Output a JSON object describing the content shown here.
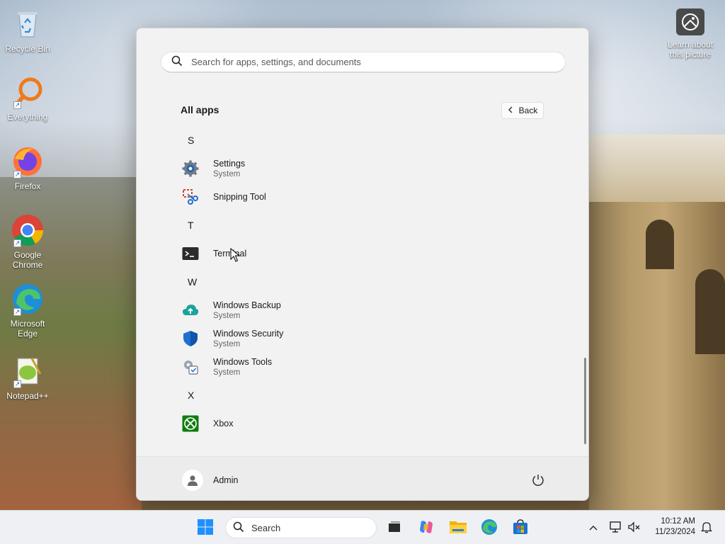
{
  "desktop": {
    "icons": [
      {
        "label": "Recycle Bin",
        "icon": "recycle-bin-icon"
      },
      {
        "label": "Everything",
        "icon": "everything-search-icon"
      },
      {
        "label": "Firefox",
        "icon": "firefox-icon"
      },
      {
        "label": "Google Chrome",
        "icon": "chrome-icon"
      },
      {
        "label": "Microsoft Edge",
        "icon": "edge-icon"
      },
      {
        "label": "Notepad++",
        "icon": "notepadpp-icon"
      }
    ],
    "learn_label": "Learn about this picture"
  },
  "start_menu": {
    "search_placeholder": "Search for apps, settings, and documents",
    "title": "All apps",
    "back_label": "Back",
    "groups": [
      {
        "letter": "S",
        "apps": [
          {
            "name": "Settings",
            "sub": "System",
            "icon": "settings-gear-icon"
          },
          {
            "name": "Snipping Tool",
            "sub": "",
            "icon": "snipping-tool-icon"
          }
        ]
      },
      {
        "letter": "T",
        "apps": [
          {
            "name": "Terminal",
            "sub": "",
            "icon": "terminal-icon"
          }
        ]
      },
      {
        "letter": "W",
        "apps": [
          {
            "name": "Windows Backup",
            "sub": "System",
            "icon": "cloud-backup-icon"
          },
          {
            "name": "Windows Security",
            "sub": "System",
            "icon": "shield-icon"
          },
          {
            "name": "Windows Tools",
            "sub": "System",
            "icon": "tools-gear-icon"
          }
        ]
      },
      {
        "letter": "X",
        "apps": [
          {
            "name": "Xbox",
            "sub": "",
            "icon": "xbox-icon"
          }
        ]
      }
    ],
    "user_name": "Admin"
  },
  "taskbar": {
    "search_label": "Search",
    "time": "10:12 AM",
    "date": "11/23/2024"
  },
  "colors": {
    "accent": "#0067c0",
    "menu_bg": "#f2f2f2",
    "taskbar_bg": "#eef0f3"
  }
}
